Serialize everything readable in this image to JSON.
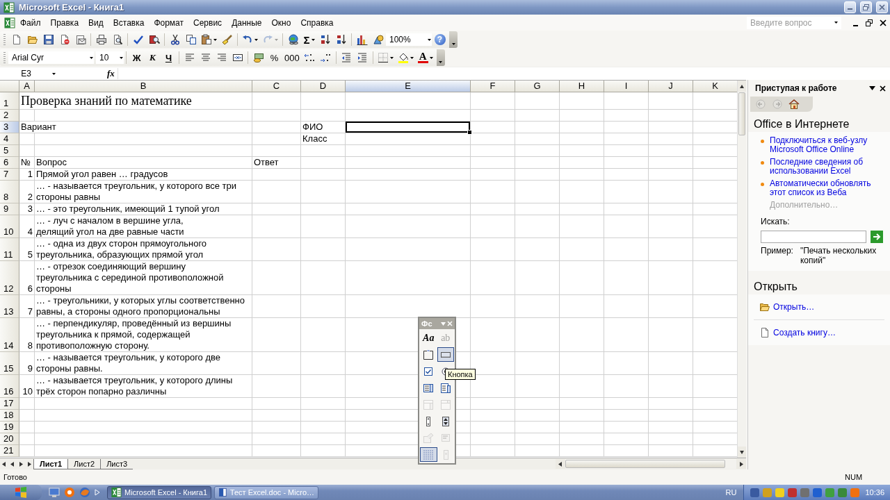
{
  "window": {
    "title": "Microsoft Excel - Книга1"
  },
  "menu": [
    "Файл",
    "Правка",
    "Вид",
    "Вставка",
    "Формат",
    "Сервис",
    "Данные",
    "Окно",
    "Справка"
  ],
  "help_search": {
    "placeholder": "Введите вопрос"
  },
  "standard_toolbar": [
    {
      "kind": "new",
      "disabled": false
    },
    {
      "kind": "open",
      "disabled": false
    },
    {
      "kind": "save",
      "disabled": false
    },
    {
      "kind": "permission",
      "disabled": false
    },
    {
      "kind": "email",
      "disabled": false
    },
    {
      "kind": "separator"
    },
    {
      "kind": "print",
      "disabled": false
    },
    {
      "kind": "preview",
      "disabled": false
    },
    {
      "kind": "separator"
    },
    {
      "kind": "spelling",
      "disabled": false
    },
    {
      "kind": "research",
      "disabled": false
    },
    {
      "kind": "separator"
    },
    {
      "kind": "cut",
      "disabled": false
    },
    {
      "kind": "copy",
      "disabled": false
    },
    {
      "kind": "paste",
      "disabled": false,
      "dropdown": true
    },
    {
      "kind": "painter",
      "disabled": false
    },
    {
      "kind": "separator"
    },
    {
      "kind": "undo",
      "disabled": false,
      "dropdown": true
    },
    {
      "kind": "redo",
      "disabled": true,
      "dropdown": true
    },
    {
      "kind": "separator"
    },
    {
      "kind": "hyperlink",
      "disabled": false
    },
    {
      "kind": "autosum",
      "label": "Σ",
      "disabled": false,
      "dropdown": true
    },
    {
      "kind": "sort-asc",
      "disabled": false
    },
    {
      "kind": "sort-desc",
      "disabled": false
    },
    {
      "kind": "separator"
    },
    {
      "kind": "chart",
      "disabled": false
    },
    {
      "kind": "drawing",
      "disabled": false
    },
    {
      "kind": "zoom",
      "value": "100%"
    },
    {
      "kind": "help",
      "label": "?",
      "disabled": false
    }
  ],
  "formatting_toolbar": {
    "font": "Arial Cyr",
    "size": "10",
    "buttons": [
      {
        "kind": "bold",
        "label": "Ж"
      },
      {
        "kind": "italic",
        "label": "К"
      },
      {
        "kind": "underline",
        "label": "Ч"
      },
      {
        "kind": "separator"
      },
      {
        "kind": "align-left"
      },
      {
        "kind": "center"
      },
      {
        "kind": "align-right"
      },
      {
        "kind": "merge"
      },
      {
        "kind": "separator"
      },
      {
        "kind": "currency"
      },
      {
        "kind": "percent",
        "label": "%"
      },
      {
        "kind": "thousands",
        "label": "000"
      },
      {
        "kind": "inc-decimal"
      },
      {
        "kind": "dec-decimal"
      },
      {
        "kind": "separator"
      },
      {
        "kind": "dec-indent"
      },
      {
        "kind": "inc-indent"
      },
      {
        "kind": "separator"
      },
      {
        "kind": "borders",
        "dropdown": true
      },
      {
        "kind": "fill",
        "dropdown": true
      },
      {
        "kind": "font-color",
        "label": "A",
        "dropdown": true
      }
    ]
  },
  "formula_bar": {
    "name_box": "E3",
    "fx": "fx"
  },
  "sheet": {
    "columns": [
      {
        "label": "A",
        "selected": false
      },
      {
        "label": "B",
        "selected": false
      },
      {
        "label": "C",
        "selected": false
      },
      {
        "label": "D",
        "selected": false
      },
      {
        "label": "E",
        "selected": true
      },
      {
        "label": "F",
        "selected": false
      },
      {
        "label": "G",
        "selected": false
      },
      {
        "label": "H",
        "selected": false
      },
      {
        "label": "I",
        "selected": false
      },
      {
        "label": "J",
        "selected": false
      },
      {
        "label": "K",
        "selected": false
      }
    ],
    "rows": [
      {
        "header": "1",
        "selected": false,
        "kind": "title",
        "a": "Проверка знаний по математике"
      },
      {
        "header": "2",
        "selected": false,
        "kind": "blank"
      },
      {
        "header": "3",
        "selected": true,
        "kind": "label",
        "a": "Вариант",
        "d": "ФИО"
      },
      {
        "header": "4",
        "selected": false,
        "kind": "label",
        "d": "Класс"
      },
      {
        "header": "5",
        "selected": false,
        "kind": "blank"
      },
      {
        "header": "6",
        "selected": false,
        "kind": "header",
        "a": "№",
        "b": "Вопрос",
        "c": "Ответ"
      },
      {
        "header": "7",
        "selected": false,
        "kind": "question",
        "a": "1",
        "b": "Прямой угол равен … градусов"
      },
      {
        "header": "8",
        "selected": false,
        "kind": "question",
        "a": "2",
        "b": "… - называется треугольник, у которого все три\nстороны равны"
      },
      {
        "header": "9",
        "selected": false,
        "kind": "question",
        "a": "3",
        "b": "… - это треугольник, имеющий 1 тупой угол"
      },
      {
        "header": "10",
        "selected": false,
        "kind": "question",
        "a": "4",
        "b": "… - луч с началом в вершине угла,\nделящий угол на две равные части"
      },
      {
        "header": "11",
        "selected": false,
        "kind": "question",
        "a": "5",
        "b": "… - одна из двух сторон прямоугольного\nтреугольника, образующих прямой угол"
      },
      {
        "header": "12",
        "selected": false,
        "kind": "question",
        "a": "6",
        "b": "… - отрезок соединяющий вершину\nтреугольника с серединой противоположной\nстороны"
      },
      {
        "header": "13",
        "selected": false,
        "kind": "question",
        "a": "7",
        "b": "… - треугольники, у которых углы соответственно\nравны, а стороны одного пропорциональны"
      },
      {
        "header": "14",
        "selected": false,
        "kind": "question",
        "a": "8",
        "b": "… - перпендикуляр, проведённый из вершины\nтреугольника к прямой, содержащей\nпротивоположную сторону."
      },
      {
        "header": "15",
        "selected": false,
        "kind": "question",
        "a": "9",
        "b": "… - называется треугольник, у которого две\nстороны равны."
      },
      {
        "header": "16",
        "selected": false,
        "kind": "question",
        "a": "10",
        "b": "… - называется треугольник, у которого длины\nтрёх сторон попарно различны"
      },
      {
        "header": "17",
        "selected": false,
        "kind": "blank"
      },
      {
        "header": "18",
        "selected": false,
        "kind": "blank"
      },
      {
        "header": "19",
        "selected": false,
        "kind": "blank"
      },
      {
        "header": "20",
        "selected": false,
        "kind": "blank"
      },
      {
        "header": "21",
        "selected": false,
        "kind": "blank"
      }
    ]
  },
  "sheet_tabs": [
    {
      "label": "Лист1",
      "selected": true
    },
    {
      "label": "Лист2",
      "selected": false
    },
    {
      "label": "Лист3",
      "selected": false
    }
  ],
  "forms_toolbar": {
    "title": "Фс",
    "tooltip": "Кнопка",
    "buttons": [
      {
        "kind": "label",
        "label": "Aa",
        "disabled": false,
        "pressed": false
      },
      {
        "kind": "editbox",
        "label": "ab",
        "disabled": true,
        "pressed": false
      },
      {
        "kind": "groupbox",
        "disabled": false,
        "pressed": false
      },
      {
        "kind": "button",
        "disabled": false,
        "pressed": true
      },
      {
        "kind": "checkbox",
        "disabled": false,
        "pressed": false
      },
      {
        "kind": "option",
        "disabled": false,
        "pressed": false
      },
      {
        "kind": "listbox",
        "disabled": false,
        "pressed": false
      },
      {
        "kind": "combobox",
        "disabled": false,
        "pressed": false
      },
      {
        "kind": "combo-list",
        "disabled": true,
        "pressed": false
      },
      {
        "kind": "combo-drop",
        "disabled": true,
        "pressed": false
      },
      {
        "kind": "scrollbar",
        "disabled": false,
        "pressed": false
      },
      {
        "kind": "spinner",
        "disabled": false,
        "pressed": false
      },
      {
        "kind": "properties",
        "disabled": true,
        "pressed": false
      },
      {
        "kind": "code",
        "disabled": true,
        "pressed": false
      },
      {
        "kind": "grid",
        "disabled": false,
        "pressed": true
      },
      {
        "kind": "dialog",
        "disabled": true,
        "pressed": false
      }
    ]
  },
  "task_pane": {
    "title": "Приступая к работе",
    "online": {
      "heading": "Office в Интернете",
      "links": [
        "Подключиться к веб-узлу Microsoft Office Online",
        "Последние сведения об использовании Excel",
        "Автоматически обновлять этот список из Веба"
      ],
      "more": "Дополнительно…",
      "search_label": "Искать:",
      "example_label": "Пример:",
      "example": "\"Печать нескольких копий\""
    },
    "open": {
      "heading": "Открыть",
      "items": [
        {
          "kind": "open",
          "label": "Открыть…"
        },
        {
          "kind": "new",
          "label": "Создать книгу…"
        }
      ]
    }
  },
  "status_bar": {
    "text": "Готово",
    "num": "NUM"
  },
  "taskbar": {
    "tasks": [
      {
        "kind": "excel",
        "label": "Microsoft Excel - Книга1",
        "selected": true
      },
      {
        "kind": "word",
        "label": "Тест Excel.doc - Micro…",
        "selected": false
      }
    ],
    "language": "RU",
    "clock": "10:36"
  }
}
